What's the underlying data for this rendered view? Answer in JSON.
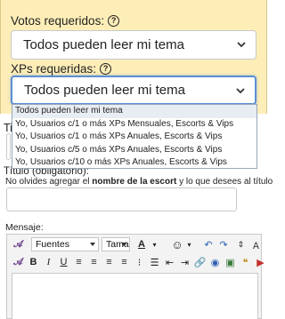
{
  "votes": {
    "label": "Votos requeridos:",
    "help_icon": "?",
    "value": "Todos pueden leer mi tema"
  },
  "xp": {
    "label": "XPs requeridas:",
    "help_icon": "?",
    "value": "Todos pueden leer mi tema",
    "options": [
      "Todos pueden leer mi tema",
      "Yo, Usuarios c/1 o más XPs Mensuales, Escorts & Vips",
      "Yo, Usuarios c/1 o más XPs Anuales, Escorts & Vips",
      "Yo, Usuarios c/5 o más XPs Anuales, Escorts & Vips",
      "Yo, Usuarios c/10 o más XPs Anuales, Escorts & Vips"
    ]
  },
  "partial_label": "Ti",
  "title_field": {
    "label": "Título (obligatorio):",
    "hint_prefix": "No olvides agregar el ",
    "hint_bold": "nombre de la escort",
    "hint_suffix": " y lo que desees al título"
  },
  "message": {
    "label": "Mensaje:",
    "font_combo": "Fuentes",
    "size_combo": "Tama",
    "text_color_icon": "A"
  },
  "colors": {
    "panel_bg": "#fdeeb8",
    "focus_border": "#5b8fd6"
  }
}
